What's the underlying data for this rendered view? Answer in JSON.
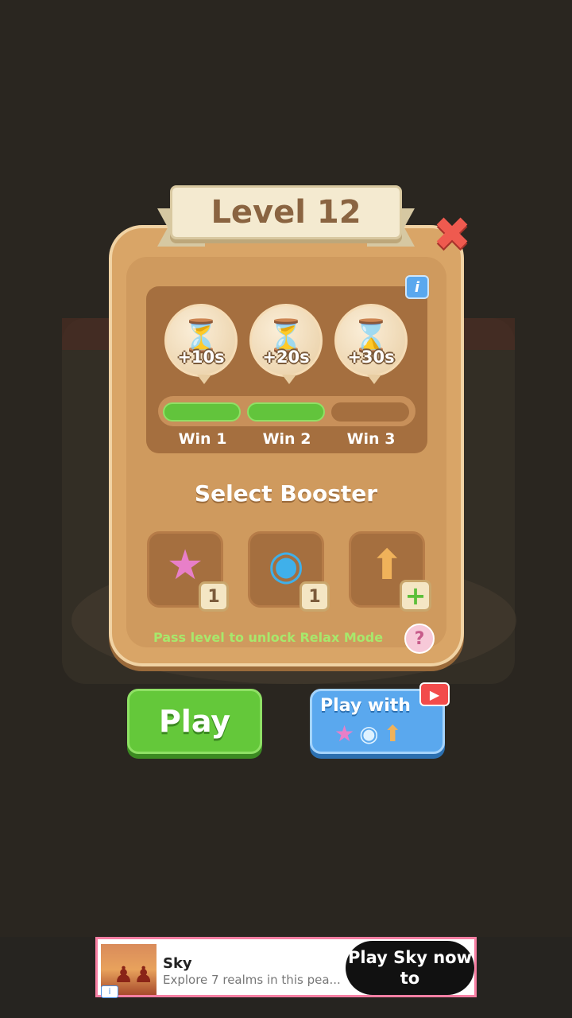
{
  "dialog": {
    "title": "Level 12",
    "close_icon": "close-icon"
  },
  "rewards": [
    {
      "label": "+10s",
      "icon": "hourglass-icon"
    },
    {
      "label": "+20s",
      "icon": "hourglass-icon"
    },
    {
      "label": "+30s",
      "icon": "hourglass-icon"
    }
  ],
  "progress": {
    "filled_segments": 2,
    "total_segments": 3,
    "wins": [
      "Win 1",
      "Win 2",
      "Win 3"
    ]
  },
  "boosters": {
    "title": "Select Booster",
    "items": [
      {
        "icon": "magic-wand-icon",
        "count": "1"
      },
      {
        "icon": "clock-check-icon",
        "count": "1"
      },
      {
        "icon": "box-arrow-up-icon",
        "count": "+"
      }
    ],
    "unlock_message": "Pass level to unlock Relax Mode"
  },
  "buttons": {
    "play": "Play",
    "play_with": "Play with"
  },
  "ad": {
    "title": "Sky",
    "description": "Explore 7 realms in this pea...",
    "cta": "Play Sky now to",
    "info": "i"
  },
  "colors": {
    "play_green": "#64c83a",
    "play_with_blue": "#5aa8ee",
    "panel_tan": "#d9a567",
    "close_red": "#ef5a4f"
  }
}
